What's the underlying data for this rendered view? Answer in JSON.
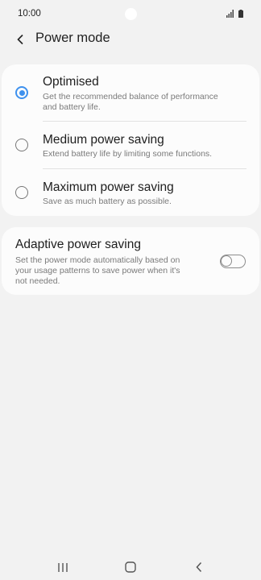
{
  "status_bar": {
    "time": "10:00"
  },
  "header": {
    "title": "Power mode"
  },
  "power_modes": [
    {
      "title": "Optimised",
      "description_lines": [
        "Get the recommended balance of performance",
        "and battery life."
      ],
      "selected": true
    },
    {
      "title": "Medium power saving",
      "description_lines": [
        "Extend battery life by limiting some functions."
      ],
      "selected": false
    },
    {
      "title": "Maximum power saving",
      "description_lines": [
        "Save as much battery as possible."
      ],
      "selected": false
    }
  ],
  "adaptive": {
    "title": "Adaptive power saving",
    "description_lines": [
      "Set the power mode automatically based on",
      "your usage patterns to save power when it's",
      "not needed."
    ],
    "enabled": false
  },
  "colors": {
    "accent": "#3e91ee",
    "background": "#f2f2f2",
    "card": "#fcfcfc"
  },
  "icons": [
    "signal-icon",
    "battery-icon",
    "back-arrow-icon",
    "recent-apps-icon",
    "home-icon",
    "nav-back-icon"
  ]
}
